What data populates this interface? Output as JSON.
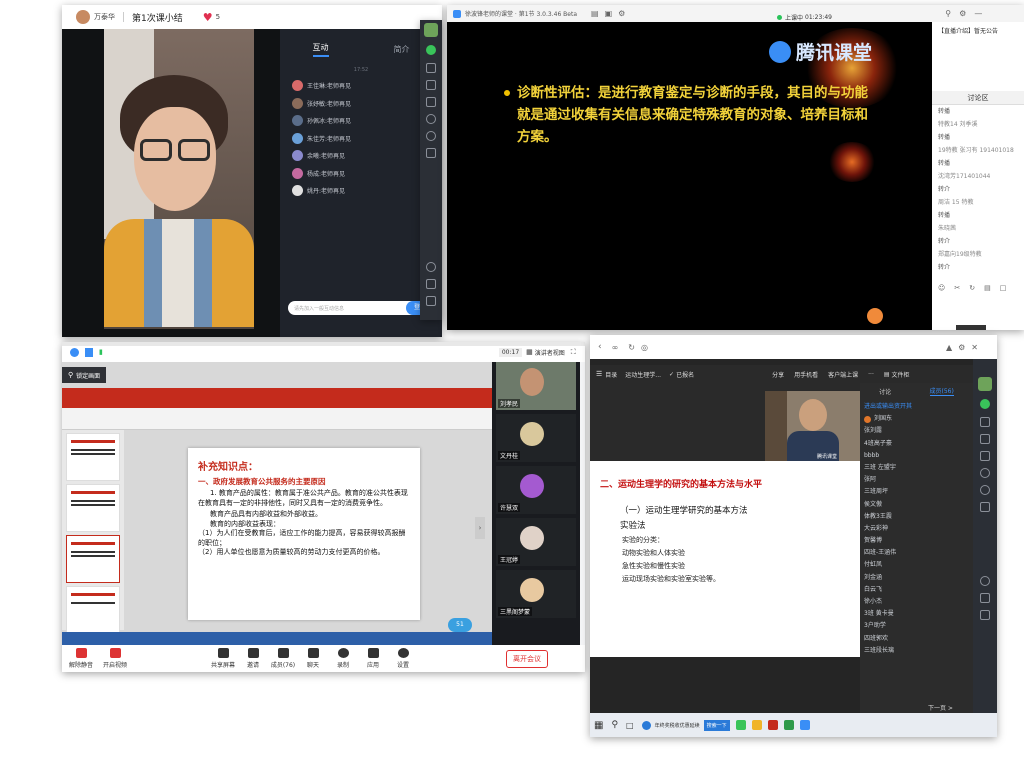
{
  "w1": {
    "host": "万泰华",
    "title": "第1次课小结",
    "likes": "5",
    "tab_interact": "互动",
    "tab_intro": "简介",
    "time": "17:52",
    "messages": [
      {
        "name": "王佳琳:",
        "text": "老师再见"
      },
      {
        "name": "张妤敏:",
        "text": "老师再见"
      },
      {
        "name": "孙佩冰:",
        "text": "老师再见"
      },
      {
        "name": "朱佳芳:",
        "text": "老师再见"
      },
      {
        "name": "余曦:",
        "text": "老师再见"
      },
      {
        "name": "杨成:",
        "text": "老师再见"
      },
      {
        "name": "姚丹:",
        "text": "老师再见"
      }
    ],
    "input_placeholder": "请先加入一般互动信息",
    "login": "登录"
  },
  "w2": {
    "title": "徐波锋老师的课堂 · 第1节 3.0.3.46 Beta",
    "status": "上课中",
    "timer": "01:23:49",
    "brand": "腾讯课堂",
    "slide_text": "诊断性评估：是进行教育鉴定与诊断的手段，其目的与功能就是通过收集有关信息来确定特殊教育的对象、培养目标和方案。",
    "side_title": "【直播介绍】暂无公告",
    "side_tab": "讨论区",
    "comments": [
      {
        "n": "转播",
        "c": "#555"
      },
      {
        "n": "特教14 刘季溪",
        "c": "#888"
      },
      {
        "n": "转播",
        "c": "#555"
      },
      {
        "n": "19特教 张习有 191401018",
        "c": "#888"
      },
      {
        "n": "转播",
        "c": "#555"
      },
      {
        "n": "沈湾芳171401044",
        "c": "#888"
      },
      {
        "n": "转介",
        "c": "#555"
      },
      {
        "n": "周洁 15 特教",
        "c": "#888"
      },
      {
        "n": "转播",
        "c": "#555"
      },
      {
        "n": "朱晓茜",
        "c": "#888"
      },
      {
        "n": "转介",
        "c": "#555"
      },
      {
        "n": "郑嘉向19级特教",
        "c": "#888"
      },
      {
        "n": "转介",
        "c": "#555"
      }
    ]
  },
  "w3": {
    "meeting_time": "00:17",
    "speaker_view": "演讲者视图",
    "lock": "锁定画面",
    "heading": "补充知识点：",
    "sub1": "一、政府发展教育公共服务的主要原因",
    "p1": "1. 教育产品的属性：教育属于准公共产品。教育的准公共性表现在教育具有一定的非排他性，同时又具有一定的消费竞争性。",
    "p2": "教育产品具有内部收益和外部收益。",
    "p3": "教育的内部收益表现：",
    "p4": "（1）为人们在受教育后，适应工作的能力提高，容易获得较高报酬的职位；",
    "p5": "（2）用人单位也愿意为质量较高的劳动力支付更高的价格。",
    "participants": [
      "刘孝民",
      "文丹桂",
      "许慧双",
      "王冠婷",
      "三黑阁梦蒙"
    ],
    "bubble": "51",
    "toolbar": {
      "mute": "解除静音",
      "video": "开启视频",
      "share": "共享屏幕",
      "invite": "邀请",
      "members": "成员(76)",
      "chat": "聊天",
      "record": "录制",
      "apps": "应用",
      "settings": "设置",
      "leave": "离开会议"
    }
  },
  "w4": {
    "menu": "目录",
    "course": "运动生理学...",
    "signed": "已报名",
    "share": "分享",
    "phone": "用手机看",
    "client": "客户端上课",
    "more": "···",
    "file": "文件柜",
    "heading": "二、运动生理学的研究的基本方法与水平",
    "sub": "（一）运动生理学研究的基本方法",
    "sub2": "实验法",
    "items": [
      "实验的分类：",
      "动物实验和人体实验",
      "急性实验和慢性实验",
      "运动现场实验和实验室实验等。"
    ],
    "tab_discuss": "讨论",
    "tab_members": "成员(56)",
    "member_list": [
      "进出或输出资开其",
      "刘国东",
      "张刘露",
      "4班高子豪",
      "bbbb",
      "三班 左盟宇",
      "张阿",
      "三班周坪",
      "侯文傲",
      "体教3王震",
      "大云彩神",
      "贺馨博",
      "四班-王涵伟",
      "付虹凤",
      "刘金涵",
      "白云飞",
      "徐小杰",
      "3班 黄卡曼",
      "3户助学",
      "四班郭欢",
      "三班段长璃"
    ],
    "brand": "腾讯课堂",
    "next": "下一页 >"
  },
  "taskbar": {
    "search": "年终奖税收优惠延续",
    "search_btn": "搜索一下"
  }
}
